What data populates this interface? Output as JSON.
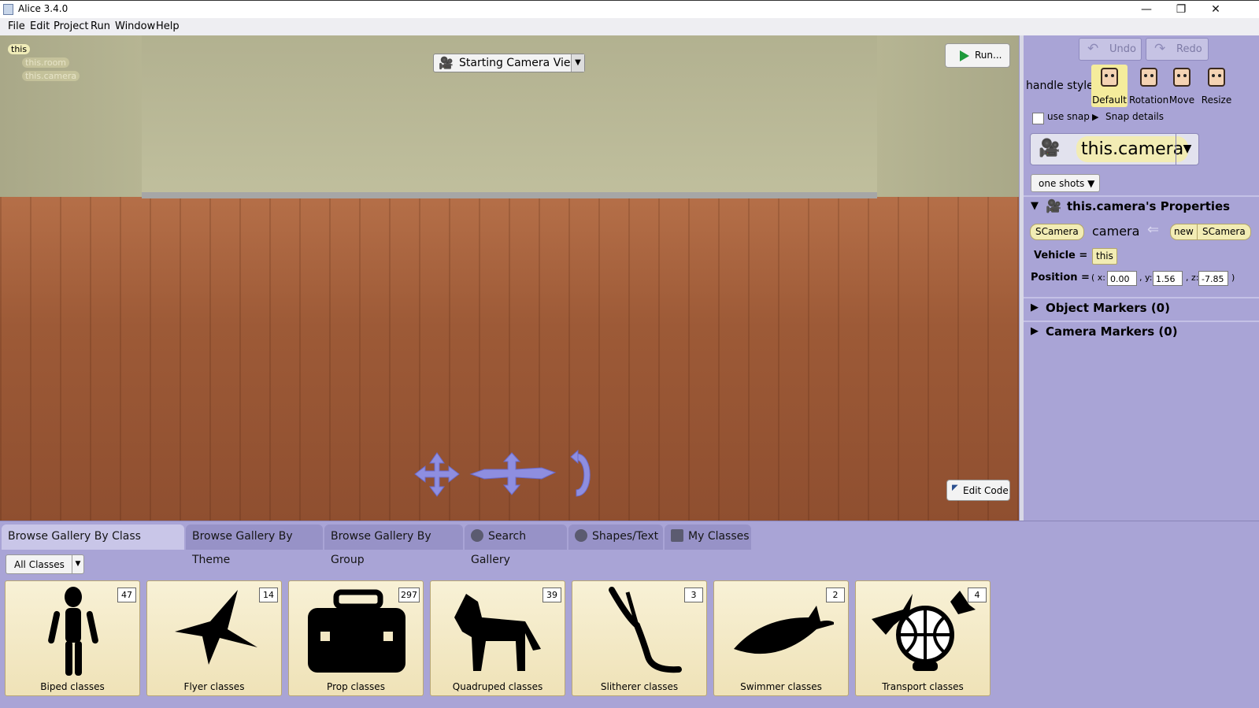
{
  "window": {
    "title": "Alice 3.4.0",
    "controls": [
      "—",
      "❐",
      "✕"
    ]
  },
  "menu": [
    "File",
    "Edit",
    "Project",
    "Run",
    "Window",
    "Help"
  ],
  "scene": {
    "tree": [
      "this",
      "this.room",
      "this.camera"
    ],
    "camera_view": "Starting Camera View",
    "run_label": "Run...",
    "edit_code_label": "Edit Code"
  },
  "right_panel": {
    "undo": "Undo",
    "redo": "Redo",
    "handle_style_label": "handle style:",
    "handle_styles": [
      "Default",
      "Rotation",
      "Move",
      "Resize"
    ],
    "selected_handle": "Default",
    "use_snap": "use snap",
    "snap_details": "Snap details",
    "selected_object": "this.camera",
    "one_shots": "one shots ▼",
    "properties_title": "this.camera's Properties",
    "type_tag": "SCamera",
    "field_name": "camera",
    "new_tag": "new",
    "new_type": "SCamera",
    "vehicle_label": "Vehicle =",
    "vehicle_value": "this",
    "position_label": "Position =",
    "position": {
      "x": "0.00",
      "y": "1.56",
      "z": "-7.85"
    },
    "object_markers": "Object Markers (0)",
    "camera_markers": "Camera Markers (0)"
  },
  "gallery": {
    "tabs": [
      "Browse Gallery By Class Hierarchy",
      "Browse Gallery By Theme",
      "Browse Gallery By Group",
      "Search Gallery",
      "Shapes/Text",
      "My Classes"
    ],
    "selected_tab": "Browse Gallery By Class Hierarchy",
    "filter": "All Classes",
    "cards": [
      {
        "label": "Biped classes",
        "count": "47",
        "icon": "biped-icon"
      },
      {
        "label": "Flyer classes",
        "count": "14",
        "icon": "flyer-icon"
      },
      {
        "label": "Prop classes",
        "count": "297",
        "icon": "prop-icon"
      },
      {
        "label": "Quadruped classes",
        "count": "39",
        "icon": "quadruped-icon"
      },
      {
        "label": "Slitherer classes",
        "count": "3",
        "icon": "slitherer-icon"
      },
      {
        "label": "Swimmer classes",
        "count": "2",
        "icon": "swimmer-icon"
      },
      {
        "label": "Transport classes",
        "count": "4",
        "icon": "transport-icon"
      }
    ]
  },
  "colors": {
    "panel": "#a9a4d6",
    "tag": "#f2ecb4",
    "card": "#f3e8c4"
  }
}
